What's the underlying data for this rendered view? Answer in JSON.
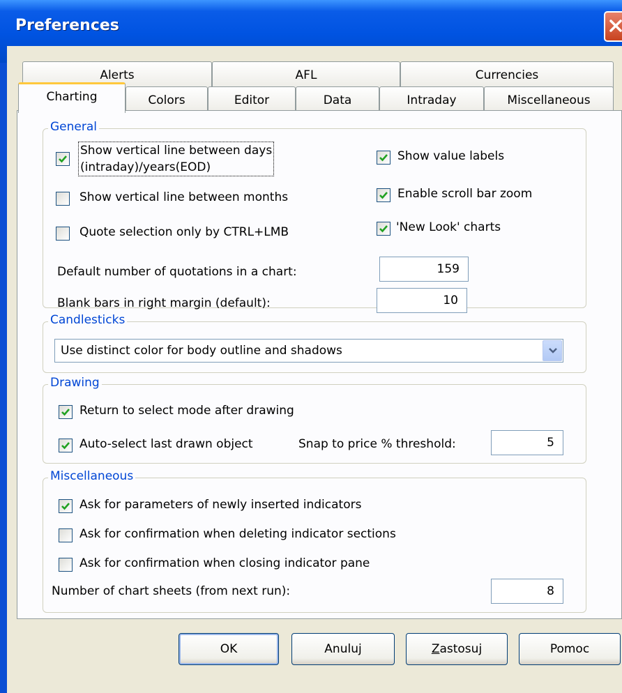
{
  "window": {
    "title": "Preferences"
  },
  "tabs_row1": [
    {
      "label": "Alerts"
    },
    {
      "label": "AFL"
    },
    {
      "label": "Currencies"
    }
  ],
  "tabs_row2": [
    {
      "label": "Charting",
      "active": true
    },
    {
      "label": "Colors"
    },
    {
      "label": "Editor"
    },
    {
      "label": "Data"
    },
    {
      "label": "Intraday"
    },
    {
      "label": "Miscellaneous"
    }
  ],
  "general": {
    "legend": "General",
    "vline_days": {
      "line1": "Show vertical line between days",
      "line2": "(intraday)/years(EOD)",
      "checked": true
    },
    "vline_months": {
      "label": "Show vertical line between months",
      "checked": false
    },
    "quote_selection": {
      "label": "Quote selection only by CTRL+LMB",
      "checked": false
    },
    "value_labels": {
      "label": "Show value labels",
      "checked": true
    },
    "scroll_zoom": {
      "label": "Enable scroll bar zoom",
      "checked": true
    },
    "new_look": {
      "label": "'New Look' charts",
      "checked": true
    },
    "default_quotes": {
      "label": "Default number of quotations in a chart:",
      "value": "159"
    },
    "blank_bars": {
      "label": "Blank bars in right margin (default):",
      "value": "10"
    }
  },
  "candlesticks": {
    "legend": "Candlesticks",
    "selected": "Use distinct color for body outline and shadows"
  },
  "drawing": {
    "legend": "Drawing",
    "return_select": {
      "label": "Return to select mode after drawing",
      "checked": true
    },
    "auto_select": {
      "label": "Auto-select last drawn object",
      "checked": true
    },
    "snap": {
      "label": "Snap to price % threshold:",
      "value": "5"
    }
  },
  "misc": {
    "legend": "Miscellaneous",
    "ask_params": {
      "label": "Ask for parameters of newly inserted indicators",
      "checked": true
    },
    "ask_delete": {
      "label": "Ask for confirmation when deleting indicator sections",
      "checked": false
    },
    "ask_close": {
      "label": "Ask for confirmation when closing indicator pane",
      "checked": false
    },
    "chart_sheets": {
      "label": "Number of chart sheets (from next run):",
      "value": "8"
    }
  },
  "buttons": {
    "ok": "OK",
    "cancel": "Anuluj",
    "apply": "Zastosuj",
    "help": "Pomoc"
  },
  "colors": {
    "titlebar": "#0053e1",
    "face": "#ece9d8",
    "legend_text": "#0046d5",
    "check_mark": "#21a121"
  }
}
